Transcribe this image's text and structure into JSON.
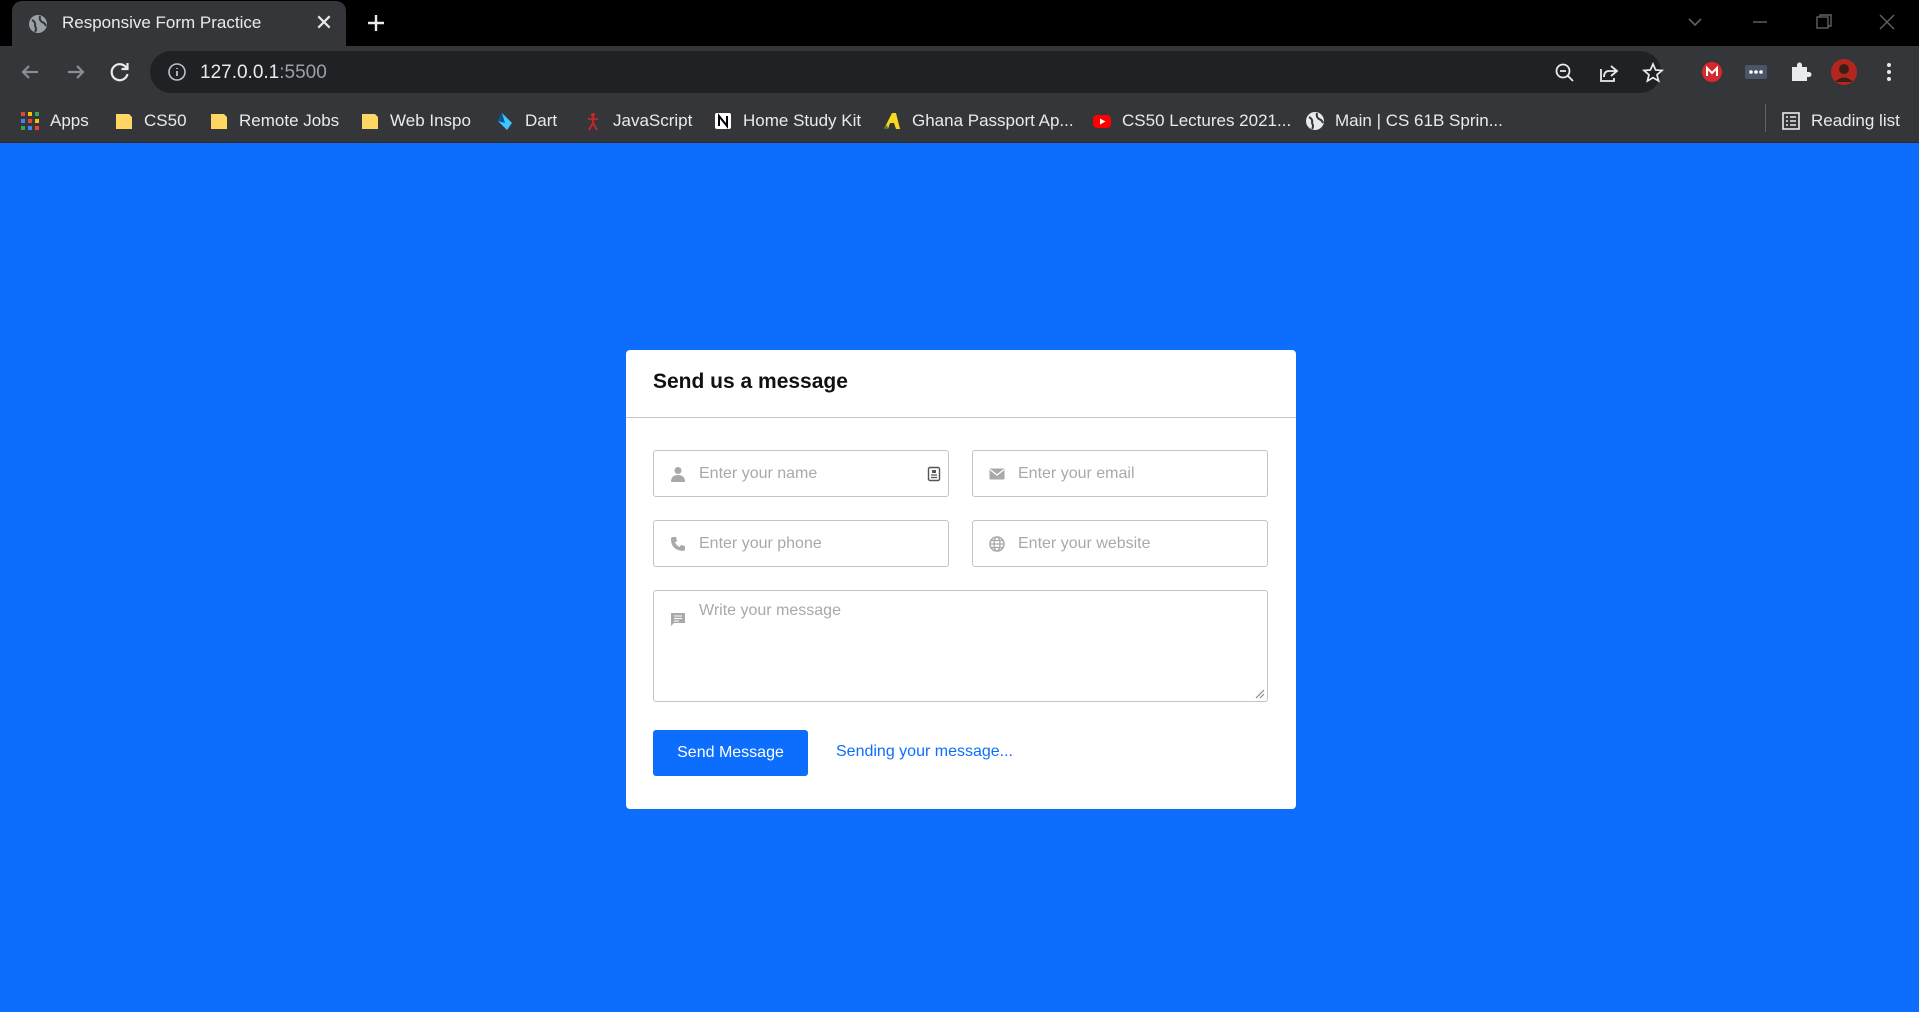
{
  "browser": {
    "tab_title": "Responsive Form Practice",
    "url_host": "127.0.0.1",
    "url_port": ":5500",
    "bookmarks": [
      {
        "label": "Apps",
        "icon": "apps-grid-icon"
      },
      {
        "label": "CS50",
        "icon": "folder-icon"
      },
      {
        "label": "Remote Jobs",
        "icon": "folder-icon"
      },
      {
        "label": "Web Inspo",
        "icon": "folder-icon"
      },
      {
        "label": "Dart",
        "icon": "dart-icon"
      },
      {
        "label": "JavaScript",
        "icon": "javascript-icon"
      },
      {
        "label": "Home Study Kit",
        "icon": "notion-icon"
      },
      {
        "label": "Ghana Passport Ap...",
        "icon": "ghana-icon"
      },
      {
        "label": "CS50 Lectures 2021...",
        "icon": "youtube-icon"
      },
      {
        "label": "Main | CS 61B Sprin...",
        "icon": "globe-icon"
      }
    ],
    "reading_list": "Reading list"
  },
  "form": {
    "title": "Send us a message",
    "name_placeholder": "Enter your name",
    "email_placeholder": "Enter your email",
    "phone_placeholder": "Enter your phone",
    "website_placeholder": "Enter your website",
    "message_placeholder": "Write your message",
    "submit_label": "Send Message",
    "status_text": "Sending your message..."
  },
  "colors": {
    "page_background": "#0d6efd",
    "accent": "#0d6efd"
  }
}
